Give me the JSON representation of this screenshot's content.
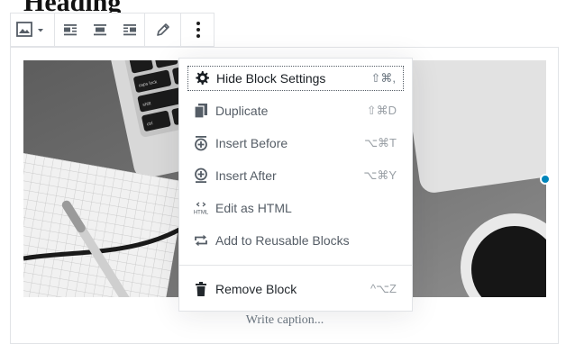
{
  "heading": "Heading",
  "toolbar": {
    "buttons": [
      {
        "name": "image-icon"
      },
      {
        "name": "align-left-icon"
      },
      {
        "name": "align-center-icon"
      },
      {
        "name": "align-right-icon"
      },
      {
        "name": "pencil-icon"
      },
      {
        "name": "more-icon"
      }
    ]
  },
  "menu": {
    "items": [
      {
        "label": "Hide Block Settings",
        "shortcut": "⇧⌘,",
        "icon": "gear-icon"
      },
      {
        "label": "Duplicate",
        "shortcut": "⇧⌘D",
        "icon": "duplicate-icon"
      },
      {
        "label": "Insert Before",
        "shortcut": "⌥⌘T",
        "icon": "insert-before-icon"
      },
      {
        "label": "Insert After",
        "shortcut": "⌥⌘Y",
        "icon": "insert-after-icon"
      },
      {
        "label": "Edit as HTML",
        "shortcut": "",
        "icon": "html-icon"
      },
      {
        "label": "Add to Reusable Blocks",
        "shortcut": "",
        "icon": "reusable-icon"
      }
    ],
    "remove": {
      "label": "Remove Block",
      "shortcut": "^⌥Z",
      "icon": "trash-icon"
    },
    "html_icon_text": "HTML"
  },
  "image": {
    "keys_row1": [
      "",
      "",
      "",
      ""
    ],
    "key_labels": {
      "caps": "caps lock",
      "shift": "shift",
      "ctrl": "ctrl"
    }
  },
  "caption": {
    "placeholder": "Write caption..."
  },
  "colors": {
    "accent": "#0085ba",
    "menu_text": "#555d66"
  }
}
